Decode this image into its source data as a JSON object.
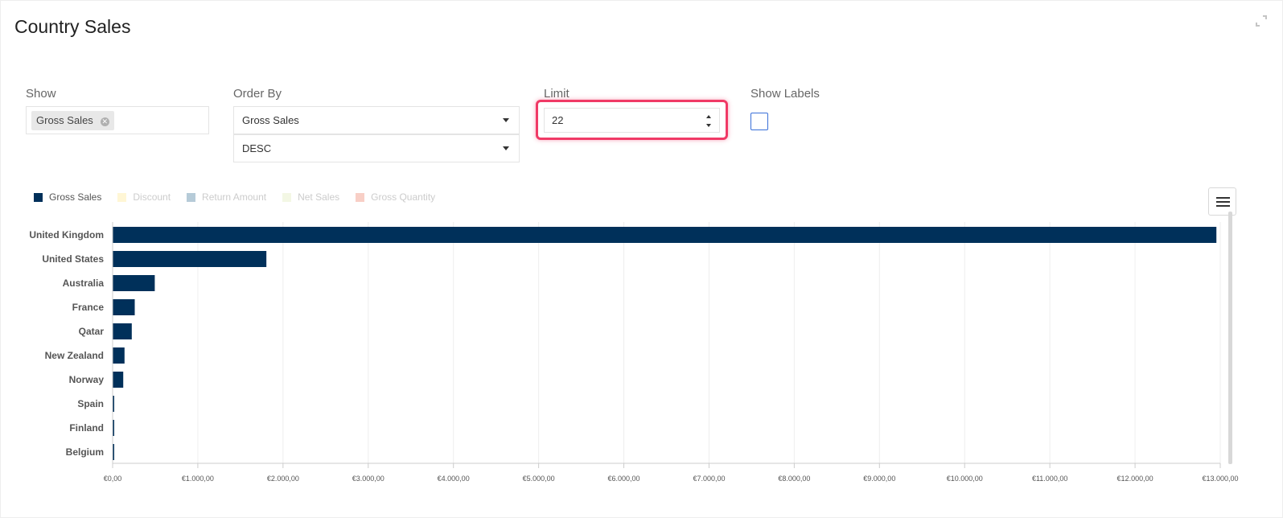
{
  "panel": {
    "title": "Country Sales"
  },
  "controls": {
    "show": {
      "label": "Show",
      "tags": [
        "Gross Sales"
      ]
    },
    "order_by": {
      "label": "Order By",
      "field": "Gross Sales",
      "direction": "DESC"
    },
    "limit": {
      "label": "Limit",
      "value": "22"
    },
    "show_labels": {
      "label": "Show Labels",
      "checked": false
    }
  },
  "legend": [
    {
      "name": "Gross Sales",
      "color": "#00305a",
      "active": true
    },
    {
      "name": "Discount",
      "color": "#fff6d5",
      "active": false
    },
    {
      "name": "Return Amount",
      "color": "#b6cbd8",
      "active": false
    },
    {
      "name": "Net Sales",
      "color": "#f3f7e4",
      "active": false
    },
    {
      "name": "Gross Quantity",
      "color": "#f8cfc6",
      "active": false
    }
  ],
  "colors": {
    "bar": "#00305a",
    "highlight": "#f03a66",
    "checkbox": "#3a6fd8"
  },
  "chart_data": {
    "type": "bar",
    "orientation": "horizontal",
    "categories": [
      "United Kingdom",
      "United States",
      "Australia",
      "France",
      "Qatar",
      "New Zealand",
      "Norway",
      "Spain",
      "Finland",
      "Belgium"
    ],
    "series": [
      {
        "name": "Gross Sales",
        "values": [
          12950,
          1800,
          490,
          255,
          220,
          135,
          120,
          10,
          8,
          6
        ]
      }
    ],
    "xlim": [
      0,
      13000
    ],
    "xticks": [
      "€0,00",
      "€1.000,00",
      "€2.000,00",
      "€3.000,00",
      "€4.000,00",
      "€5.000,00",
      "€6.000,00",
      "€7.000,00",
      "€8.000,00",
      "€9.000,00",
      "€10.000,00",
      "€11.000,00",
      "€12.000,00",
      "€13.000,00"
    ],
    "grid": true
  }
}
